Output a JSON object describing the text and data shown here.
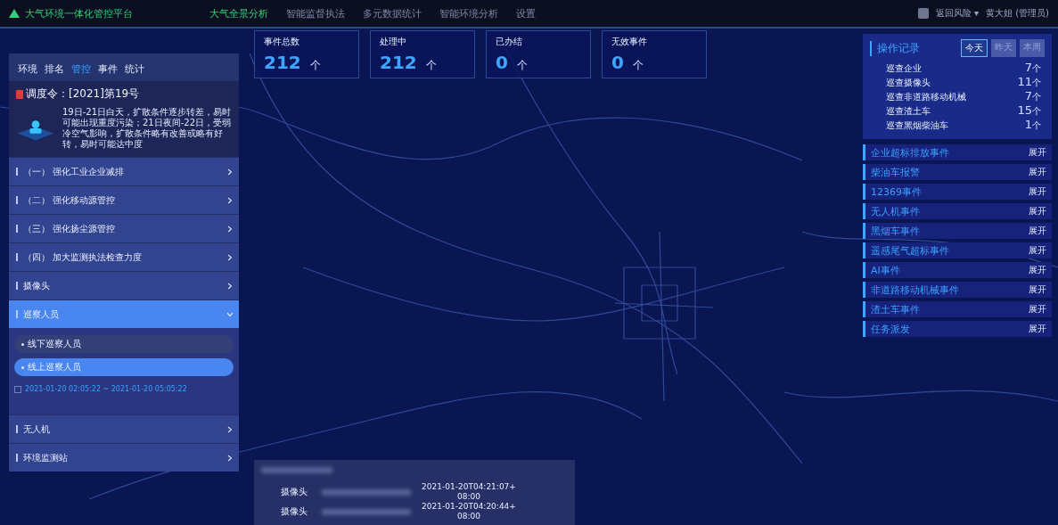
{
  "header": {
    "title": "大气环境一体化管控平台",
    "nav": [
      {
        "label": "大气全景分析",
        "selected": true
      },
      {
        "label": "智能监督执法",
        "selected": false
      },
      {
        "label": "多元数据统计",
        "selected": false
      },
      {
        "label": "智能环境分析",
        "selected": false
      },
      {
        "label": "设置",
        "selected": false
      }
    ],
    "user_menu": "返回风险 ▾",
    "user": "黄大姐 (管理员)"
  },
  "left_panel": {
    "tabs": [
      {
        "label": "环境",
        "selected": false
      },
      {
        "label": "排名",
        "selected": false
      },
      {
        "label": "管控",
        "selected": true
      },
      {
        "label": "事件",
        "selected": false
      },
      {
        "label": "统计",
        "selected": false
      }
    ],
    "order_title": "调度令：[2021]第19号",
    "order_text": "19日-21日白天，扩散条件逐步转差，易时可能出现重度污染；21日夜间-22日，受弱冷空气影响，扩散条件略有改善或略有好转，易时可能达中度",
    "items": [
      {
        "label": "（一） 强化工业企业减排",
        "expanded": false
      },
      {
        "label": "（二） 强化移动源管控",
        "expanded": false
      },
      {
        "label": "（三） 强化扬尘源管控",
        "expanded": false
      },
      {
        "label": "（四） 加大监测执法检查力度",
        "expanded": false
      },
      {
        "label": "摄像头",
        "expanded": false
      },
      {
        "label": "巡察人员",
        "expanded": true,
        "children": [
          {
            "label": "线下巡察人员",
            "selected": false
          },
          {
            "label": "线上巡察人员",
            "selected": true
          }
        ],
        "date_range": "2021-01-20 02:05:22 ~ 2021-01-20 05:05:22"
      },
      {
        "label": "无人机",
        "expanded": false
      },
      {
        "label": "环境监测站",
        "expanded": false
      }
    ]
  },
  "stats": [
    {
      "label": "事件总数",
      "value": "212",
      "unit": "个"
    },
    {
      "label": "处理中",
      "value": "212",
      "unit": "个"
    },
    {
      "label": "已办结",
      "value": "0",
      "unit": "个"
    },
    {
      "label": "无效事件",
      "value": "0",
      "unit": "个"
    }
  ],
  "records": {
    "title": "操作记录",
    "tabs": [
      {
        "label": "今天",
        "selected": true
      },
      {
        "label": "昨天",
        "selected": false
      },
      {
        "label": "本周",
        "selected": false
      }
    ],
    "rows": [
      {
        "label": "巡查企业",
        "count": "7",
        "unit": "个"
      },
      {
        "label": "巡查摄像头",
        "count": "11",
        "unit": "个"
      },
      {
        "label": "巡查非道路移动机械",
        "count": "7",
        "unit": "个"
      },
      {
        "label": "巡查渣土车",
        "count": "15",
        "unit": "个"
      },
      {
        "label": "巡查黑烟柴油车",
        "count": "1",
        "unit": "个"
      }
    ]
  },
  "events": [
    {
      "label": "企业超标排放事件",
      "action": "展开"
    },
    {
      "label": "柴油车报警",
      "action": "展开"
    },
    {
      "label": "12369事件",
      "action": "展开"
    },
    {
      "label": "无人机事件",
      "action": "展开"
    },
    {
      "label": "黑烟车事件",
      "action": "展开"
    },
    {
      "label": "遥感尾气超标事件",
      "action": "展开"
    },
    {
      "label": "AI事件",
      "action": "展开"
    },
    {
      "label": "非道路移动机械事件",
      "action": "展开"
    },
    {
      "label": "渣土车事件",
      "action": "展开"
    },
    {
      "label": "任务派发",
      "action": "展开"
    }
  ],
  "popup": {
    "rows": [
      {
        "type": "摄像头",
        "time": "2021-01-20T04:21:07+08:00"
      },
      {
        "type": "摄像头",
        "time": "2021-01-20T04:20:44+08:00"
      }
    ]
  }
}
